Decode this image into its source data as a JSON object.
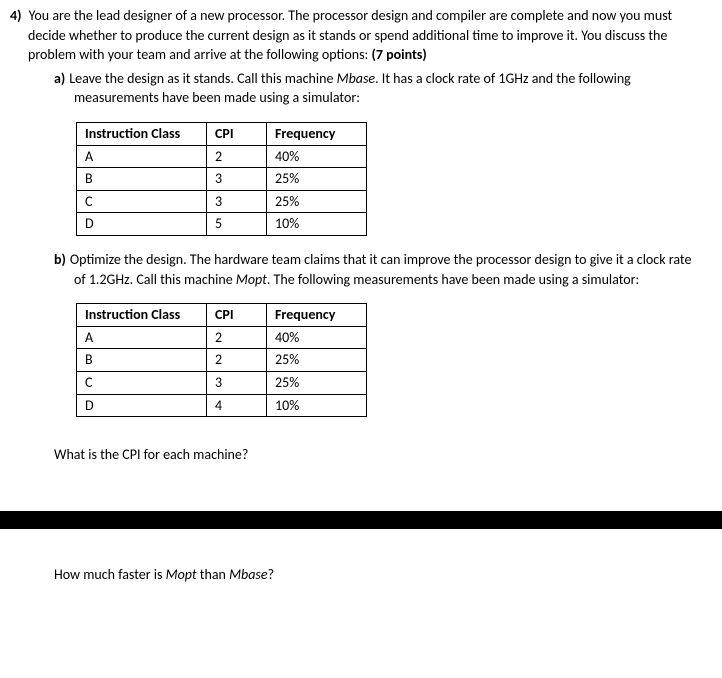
{
  "question_number": "4)",
  "intro_text": "You are the lead designer of a new processor. The processor design and compiler are complete and now you must decide whether to produce the current design as it stands or spend additional time to improve it. You discuss the problem with your team and arrive at the following options: ",
  "points": "(7 points)",
  "part_a": {
    "label": "a)",
    "text_before": "Leave the design as it stands. Call this machine ",
    "machine": "Mbase",
    "text_after": ". It has a clock rate of 1GHz and the following measurements have been made using a simulator:"
  },
  "table_a": {
    "headers": [
      "Instruction Class",
      "CPI",
      "Frequency"
    ],
    "rows": [
      [
        "A",
        "2",
        "40%"
      ],
      [
        "B",
        "3",
        "25%"
      ],
      [
        "C",
        "3",
        "25%"
      ],
      [
        "D",
        "5",
        "10%"
      ]
    ]
  },
  "part_b": {
    "label": "b)",
    "text_before": "Optimize the design. The hardware team claims that it can improve the processor design to give it a clock rate of 1.2GHz. Call this machine ",
    "machine": "Mopt",
    "text_after": ". The following measurements have been made using a simulator:"
  },
  "table_b": {
    "headers": [
      "Instruction Class",
      "CPI",
      "Frequency"
    ],
    "rows": [
      [
        "A",
        "2",
        "40%"
      ],
      [
        "B",
        "2",
        "25%"
      ],
      [
        "C",
        "3",
        "25%"
      ],
      [
        "D",
        "4",
        "10%"
      ]
    ]
  },
  "q1": "What is the CPI for each machine?",
  "q2_before": "How much faster is ",
  "q2_m1": "Mopt",
  "q2_mid": " than ",
  "q2_m2": "Mbase",
  "q2_after": "?"
}
